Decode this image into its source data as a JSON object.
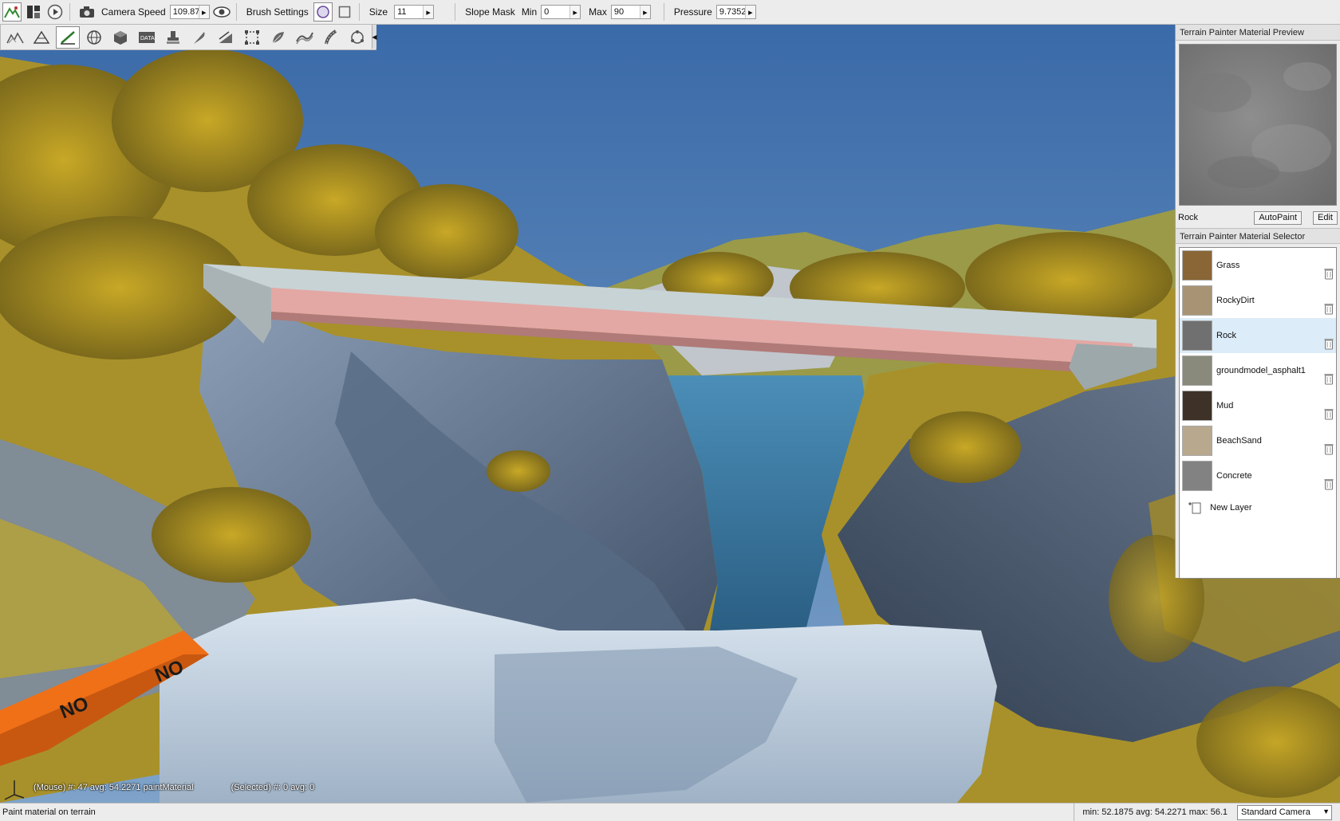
{
  "toolbar": {
    "camera_speed_label": "Camera Speed",
    "camera_speed_value": "109.87",
    "brush_settings_label": "Brush Settings",
    "size_label": "Size",
    "size_value": "11",
    "slope_mask_label": "Slope Mask",
    "min_label": "Min",
    "min_value": "0",
    "max_label": "Max",
    "max_value": "90",
    "pressure_label": "Pressure",
    "pressure_value": "9.7352"
  },
  "preview_panel": {
    "title": "Terrain Painter Material Preview",
    "material_name": "Rock",
    "autopaint_label": "AutoPaint",
    "edit_label": "Edit"
  },
  "selector_panel": {
    "title": "Terrain Painter Material Selector",
    "materials": [
      {
        "name": "Grass",
        "color": "#8a6636"
      },
      {
        "name": "RockyDirt",
        "color": "#a89474"
      },
      {
        "name": "Rock",
        "color": "#707070"
      },
      {
        "name": "groundmodel_asphalt1",
        "color": "#8a8a7c"
      },
      {
        "name": "Mud",
        "color": "#3e3228"
      },
      {
        "name": "BeachSand",
        "color": "#b8a88e"
      },
      {
        "name": "Concrete",
        "color": "#828282"
      }
    ],
    "selected_index": 2,
    "new_layer_label": "New Layer"
  },
  "hud": {
    "mouse_info": "(Mouse) #: 47  avg: 54.2271 paintMaterial",
    "selected_info": "(Selected) #: 0  avg: 0"
  },
  "status": {
    "message": "Paint material on terrain",
    "stats": "min: 52.1875  avg: 54.2271  max: 56.1",
    "camera": "Standard Camera"
  }
}
